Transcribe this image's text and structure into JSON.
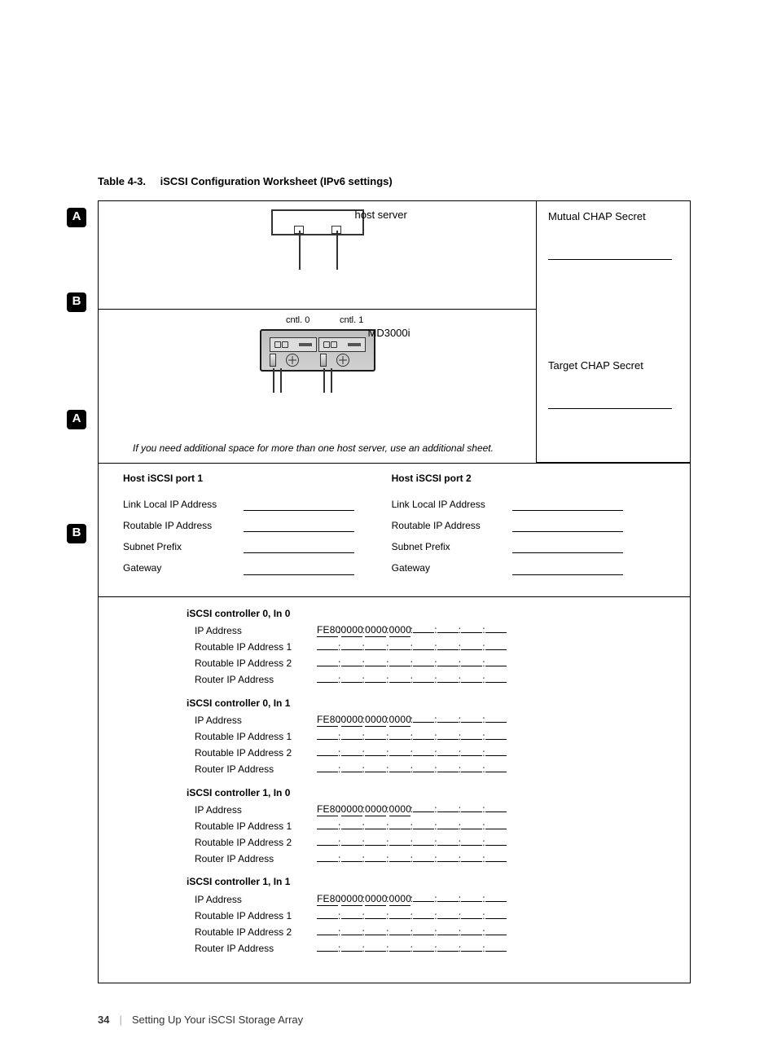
{
  "caption": {
    "number": "Table 4-3.",
    "title": "iSCSI Configuration Worksheet (IPv6 settings)"
  },
  "badges": {
    "a": "A",
    "b": "B"
  },
  "diagramTop": {
    "hostLabel": "host server"
  },
  "diagramMid": {
    "cntl0": "cntl. 0",
    "cntl1": "cntl. 1",
    "device": "MD3000i"
  },
  "chap": {
    "mutualLabel": "Mutual CHAP Secret",
    "targetLabel": "Target CHAP Secret"
  },
  "note": "If you need additional space for more than one host server, use an additional sheet.",
  "hostPorts": {
    "port1": {
      "title": "Host iSCSI port 1",
      "fields": [
        "Link Local IP Address",
        "Routable IP Address",
        "Subnet Prefix",
        "Gateway"
      ]
    },
    "port2": {
      "title": "Host iSCSI port 2",
      "fields": [
        "Link Local IP Address",
        "Routable IP Address",
        "Subnet Prefix",
        "Gateway"
      ]
    }
  },
  "controllers": [
    {
      "title": "iSCSI controller 0, In 0"
    },
    {
      "title": "iSCSI controller 0, In 1"
    },
    {
      "title": "iSCSI controller 1, In 0"
    },
    {
      "title": "iSCSI controller 1, In 1"
    }
  ],
  "controllerRows": {
    "ipAddress": "IP Address",
    "routable1": "Routable IP Address 1",
    "routable2": "Routable IP Address 2",
    "routerIp": "Router IP Address"
  },
  "ipv6LinkLocalPrefix": [
    "FE80",
    "0000",
    "0000",
    "0000"
  ],
  "footer": {
    "page": "34",
    "section": "Setting Up Your iSCSI Storage Array"
  }
}
